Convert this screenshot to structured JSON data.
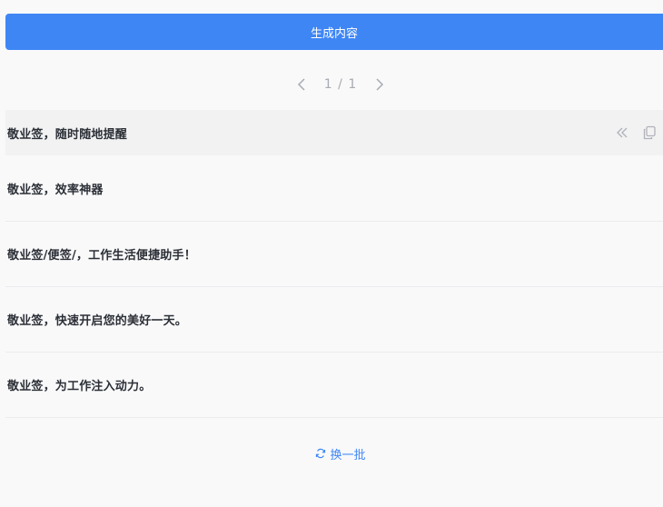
{
  "generate_button": {
    "label": "生成内容"
  },
  "pager": {
    "current": "1",
    "separator": "/",
    "total": "1"
  },
  "items": [
    {
      "text": "敬业签，随时随地提醒"
    },
    {
      "text": "敬业签，效率神器"
    },
    {
      "text": "敬业签/便签/，工作生活便捷助手！"
    },
    {
      "text": "敬业签，快速开启您的美好一天。"
    },
    {
      "text": "敬业签，为工作注入动力。"
    }
  ],
  "refresh": {
    "label": "换一批",
    "icon": "refresh-icon"
  },
  "colors": {
    "accent": "#3f86f5",
    "background": "#f9f9fa",
    "active_row": "#f2f2f3",
    "text": "#2b2f36",
    "muted": "#a8abb2"
  }
}
